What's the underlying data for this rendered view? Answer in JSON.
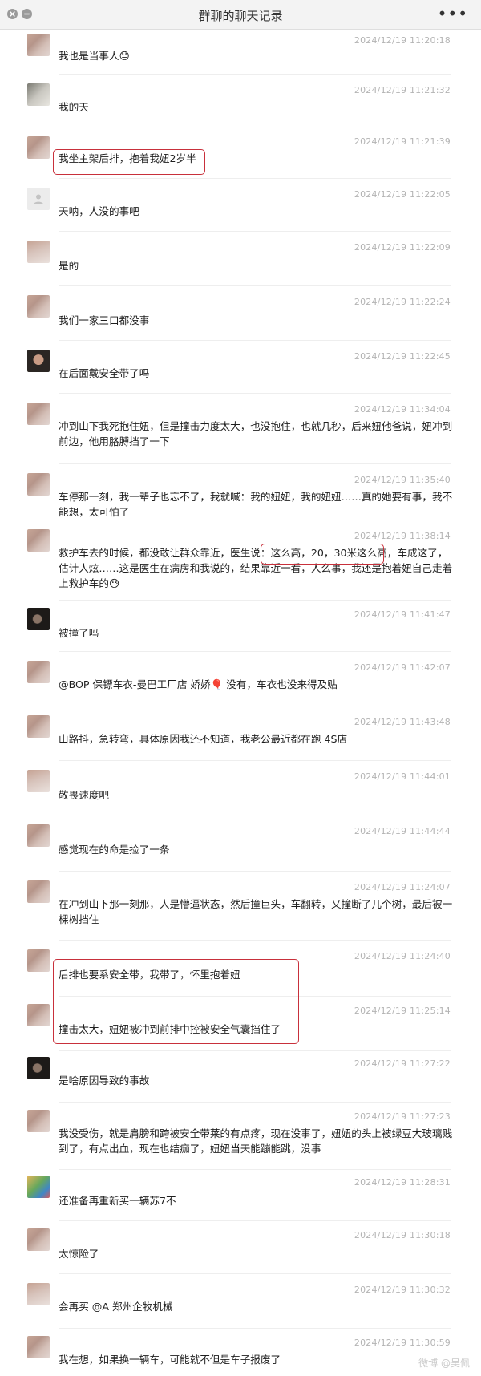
{
  "window": {
    "title": "群聊的聊天记录",
    "more_icon": "more-dots-icon",
    "close_icon": "close-icon",
    "minimize_icon": "minimize-icon"
  },
  "messages": [
    {
      "time": "2024/12/19 11:20:18",
      "text": "我也是当事人😓"
    },
    {
      "time": "2024/12/19 11:21:32",
      "text": "我的天"
    },
    {
      "time": "2024/12/19 11:21:39",
      "text": "我坐主架后排，抱着我妞2岁半"
    },
    {
      "time": "2024/12/19 11:22:05",
      "text": "天呐，人没的事吧"
    },
    {
      "time": "2024/12/19 11:22:09",
      "text": "是的"
    },
    {
      "time": "2024/12/19 11:22:24",
      "text": "我们一家三口都没事"
    },
    {
      "time": "2024/12/19 11:22:45",
      "text": "在后面戴安全带了吗"
    },
    {
      "time": "2024/12/19 11:34:04",
      "text": "冲到山下我死抱住妞，但是撞击力度太大，也没抱住，也就几秒，后来妞他爸说，妞冲到前边，他用胳膊挡了一下"
    },
    {
      "time": "2024/12/19 11:35:40",
      "text": "车停那一刻，我一辈子也忘不了，我就喊：我的妞妞，我的妞妞……真的她要有事，我不能想，太可怕了"
    },
    {
      "time": "2024/12/19 11:38:14",
      "text": "救护车去的时候，都没敢让群众靠近，医生说：这么高，20，30米这么高，车成这了，估计人炫……这是医生在病房和我说的，结果靠近一看，人么事，我还是抱着妞自己走着上救护车的😓"
    },
    {
      "time": "2024/12/19 11:41:47",
      "text": "被撞了吗"
    },
    {
      "time": "2024/12/19 11:42:07",
      "text": "@BOP 保镖车衣-曼巴工厂店 娇娇🎈 没有，车衣也没来得及贴"
    },
    {
      "time": "2024/12/19 11:43:48",
      "text": "山路抖，急转弯，具体原因我还不知道，我老公最近都在跑 4S店"
    },
    {
      "time": "2024/12/19 11:44:01",
      "text": "敬畏速度吧"
    },
    {
      "time": "2024/12/19 11:44:44",
      "text": "感觉现在的命是捡了一条"
    },
    {
      "time": "2024/12/19 11:24:07",
      "text": "在冲到山下那一刻那，人是懵逼状态，然后撞巨头，车翻转，又撞断了几个树，最后被一棵树挡住"
    },
    {
      "time": "2024/12/19 11:24:40",
      "text": "后排也要系安全带，我带了，怀里抱着妞"
    },
    {
      "time": "2024/12/19 11:25:14",
      "text": "撞击太大，妞妞被冲到前排中控被安全气囊挡住了"
    },
    {
      "time": "2024/12/19 11:27:22",
      "text": "是啥原因导致的事故"
    },
    {
      "time": "2024/12/19 11:27:23",
      "text": "我没受伤，就是肩膀和跨被安全带莱的有点疼，现在没事了，妞妞的头上被绿豆大玻璃贱到了，有点出血，现在也结痂了，妞妞当天能蹦能跳，没事"
    },
    {
      "time": "2024/12/19 11:28:31",
      "text": "还准备再重新买一辆苏7不"
    },
    {
      "time": "2024/12/19 11:30:18",
      "text": "太惊险了"
    },
    {
      "time": "2024/12/19 11:30:32",
      "text": "会再买 @A 郑州企牧机械"
    },
    {
      "time": "2024/12/19 11:30:59",
      "text": "我在想，如果换一辆车，可能就不但是车子报废了"
    }
  ],
  "watermark": "微博 @吴佩"
}
